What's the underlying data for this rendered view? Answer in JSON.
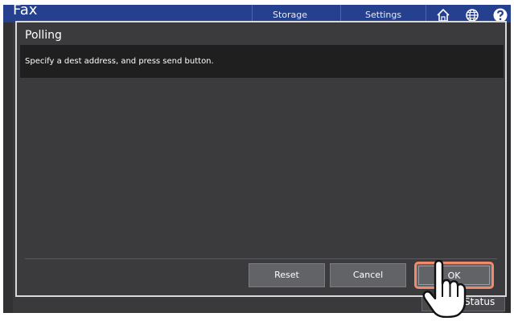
{
  "app": {
    "title": "Fax",
    "tabs": [
      "Storage",
      "Settings"
    ],
    "icons": [
      "home-icon",
      "globe-icon",
      "help-icon"
    ],
    "status_label": "Status"
  },
  "dialog": {
    "title": "Polling",
    "message": "Specify a dest address, and press send button.",
    "buttons": {
      "reset": "Reset",
      "cancel": "Cancel",
      "ok": "OK"
    }
  },
  "colors": {
    "header": "#24408e",
    "dialog_bg": "#3b3b3e",
    "ok_highlight": "#f08a6a"
  }
}
